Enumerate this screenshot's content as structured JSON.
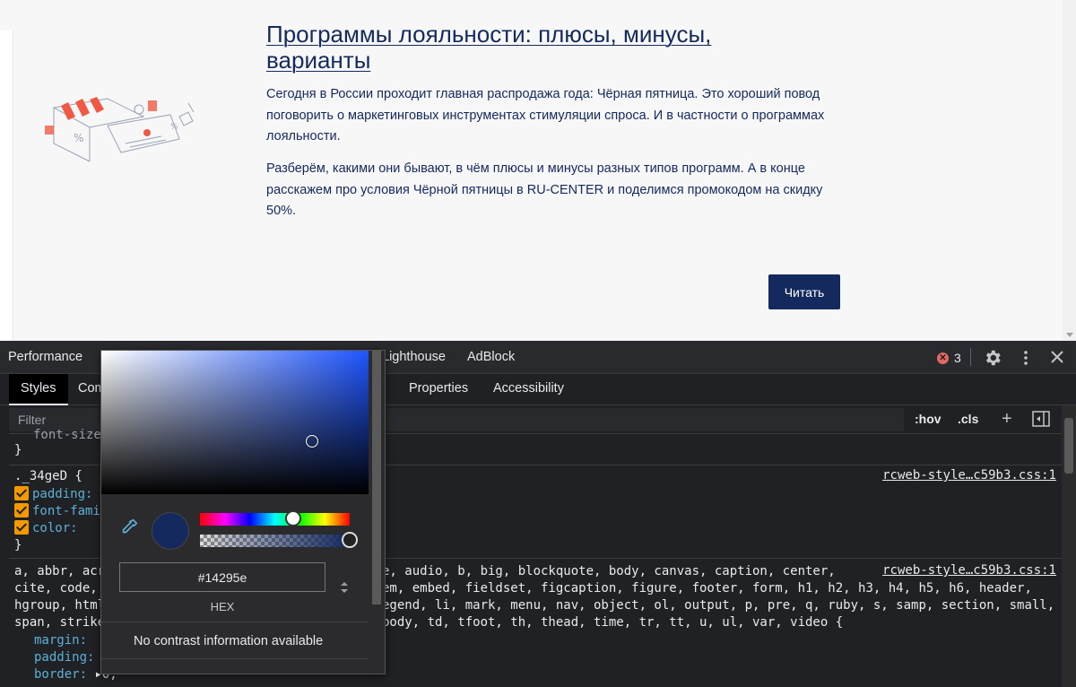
{
  "article": {
    "title": "Программы лояльности: плюсы, минусы, варианты",
    "paragraph1": "Сегодня в России проходит главная распродажа года: Чёрная пятница. Это хороший повод поговорить о маркетинговых инструментах стимуляции спроса. И в частности о программах лояльности.",
    "paragraph2": "Разберём, какими они бывают, в чём плюсы и минусы разных типов программ. А в конце расскажем про условия Чёрной пятницы в RU-CENTER и поделимся промокодом на скидку 50%.",
    "read_button": "Читать",
    "illustration": "loyalty-shop-illustration"
  },
  "devtools": {
    "main_tabs": [
      "Performance",
      "Lighthouse",
      "AdBlock"
    ],
    "error_count": "3",
    "sub_tabs": [
      "Styles",
      "Com",
      "Properties",
      "Accessibility"
    ],
    "filter_placeholder": "Filter",
    "hov": ":hov",
    "cls": ".cls",
    "rules": {
      "prev_tail_line": "font-size",
      "close_brace": "}",
      "rule1_selector": "._34geD {",
      "rule1_props": [
        "padding:",
        "font-fami",
        "color:"
      ],
      "rule1_link": "rcweb-style…c59b3.css:1",
      "rule2_link": "rcweb-style…c59b3.css:1",
      "rule2_line1_left": "a, abbr, acr",
      "rule2_line1_right": "e, audio, b, big, blockquote, body, canvas, caption, center,",
      "rule2_line2_left": "cite, code, ",
      "rule2_line2_right": "em, embed, fieldset, figcaption, figure, footer, form, h1, h2, h3, h4, h5, h6, header,",
      "rule2_line3_left": "hgroup, html",
      "rule2_line3_right": "egend, li, mark, menu, nav, object, ol, output, p, pre, q, ruby, s, samp, section, small,",
      "rule2_line4_left": "span, strike",
      "rule2_line4_right": "body, td, tfoot, th, thead, time, tr, tt, u, ul, var, video {",
      "rule2_props": [
        "margin:",
        "padding:",
        "border:"
      ],
      "border_value": "0;"
    }
  },
  "color_picker": {
    "hex_value": "#14295e",
    "format_label": "HEX",
    "contrast_text": "No contrast information available",
    "swatch_color": "#14295e",
    "hue_position": 0.62,
    "alpha_position": 1.0
  }
}
